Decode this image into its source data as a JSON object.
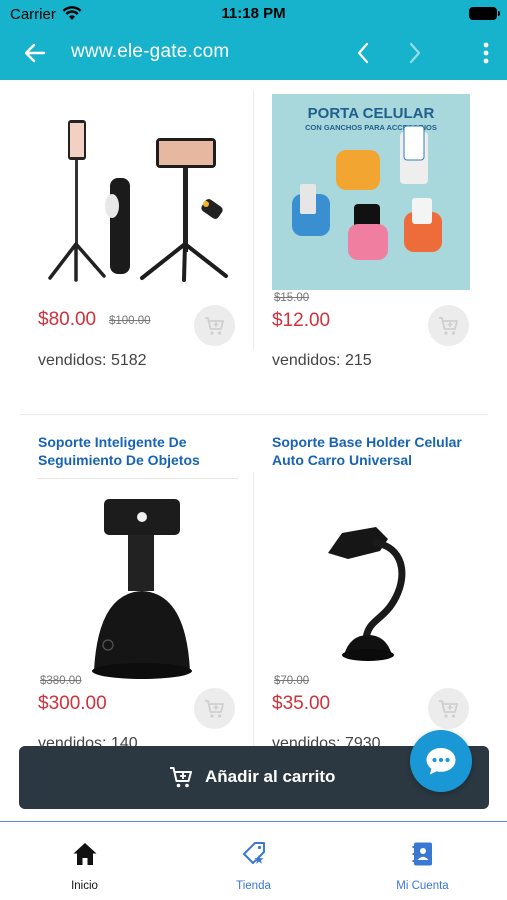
{
  "status_bar": {
    "carrier": "Carrier",
    "time": "11:18 PM"
  },
  "browser": {
    "url": "www.ele-gate.com"
  },
  "products": [
    {
      "title": "",
      "image_alt": "selfie-stick-tripod",
      "old_price": "$100.00",
      "price": "$80.00",
      "sold": "vendidos: 5182"
    },
    {
      "title": "",
      "image_alt": "porta-celular-wall-holders",
      "image_text_1": "PORTA CELULAR",
      "image_text_2": "CON GANCHOS PARA ACCESORIOS",
      "old_price": "$15.00",
      "price": "$12.00",
      "sold": "vendidos: 215"
    },
    {
      "title": "Soporte Inteligente De Seguimiento De Objetos",
      "image_alt": "auto-tracking-phone-mount",
      "old_price": "$380.00",
      "price": "$300.00",
      "sold": "vendidos: 140"
    },
    {
      "title": "Soporte Base Holder Celular Auto Carro Universal",
      "image_alt": "car-phone-holder",
      "old_price": "$70.00",
      "price": "$35.00",
      "sold": "vendidos: 7930"
    }
  ],
  "actions": {
    "add_to_cart": "Añadir al carrito"
  },
  "tabs": [
    {
      "label": "Inicio",
      "icon": "home-icon"
    },
    {
      "label": "Tienda",
      "icon": "tag-star-icon"
    },
    {
      "label": "Mi Cuenta",
      "icon": "contact-book-icon"
    }
  ],
  "colors": {
    "toolbar": "#17b3cc",
    "price": "#d1313a",
    "title": "#1763b8",
    "add_bar": "#2b3841",
    "chat": "#1a98d5",
    "tab_active": "#111111",
    "tab_inactive": "#3a78d4"
  }
}
